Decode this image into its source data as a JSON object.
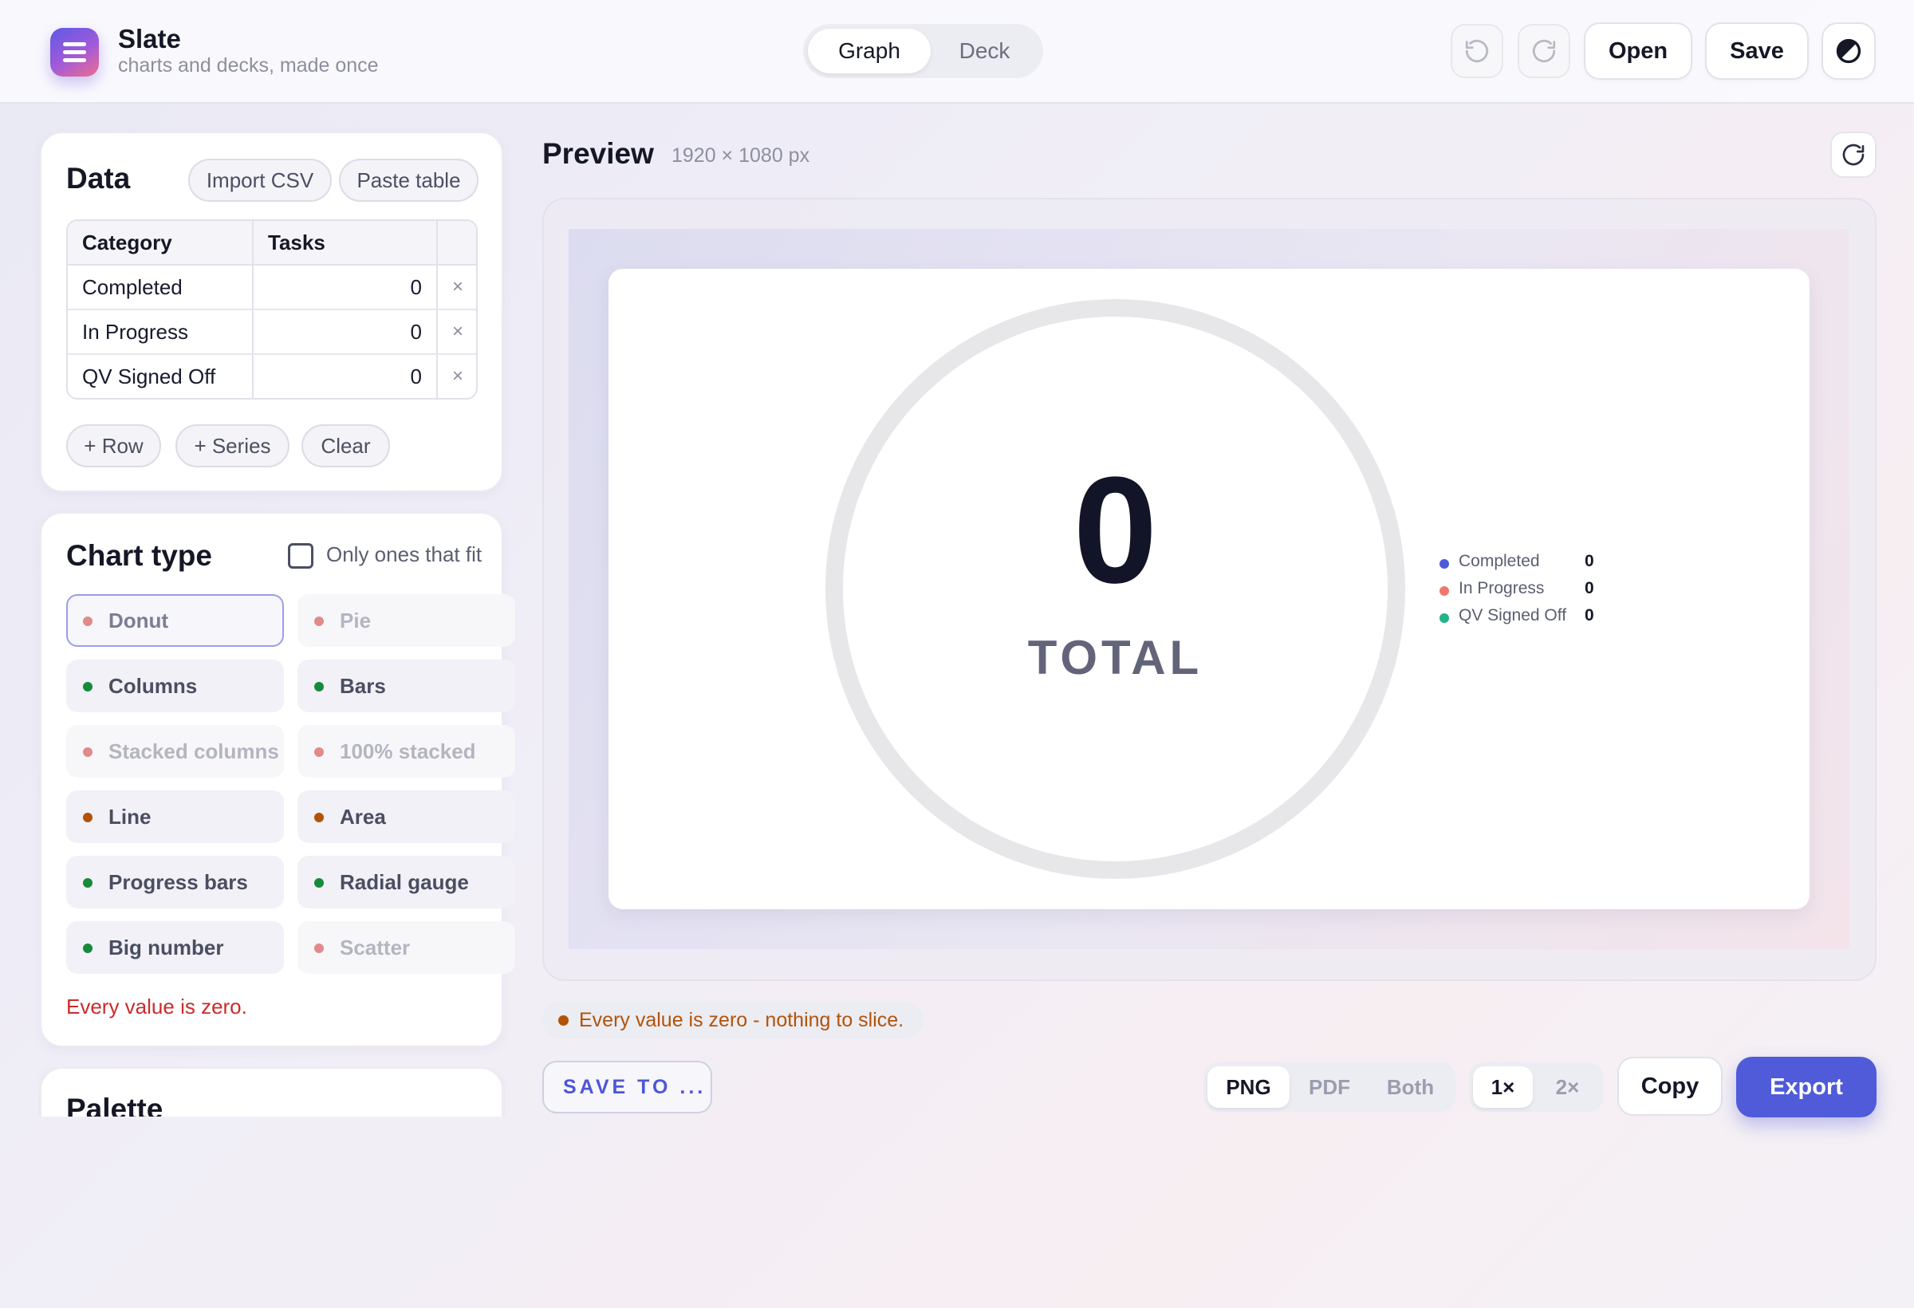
{
  "app": {
    "title": "Slate",
    "subtitle": "charts and decks, made once"
  },
  "mode_switch": {
    "options": [
      "Graph",
      "Deck"
    ],
    "active": "Graph"
  },
  "toolbar": {
    "open_label": "Open",
    "save_label": "Save",
    "undo_icon": "undo-icon",
    "redo_icon": "redo-icon",
    "theme_icon": "contrast-icon"
  },
  "data_panel": {
    "title": "Data",
    "import_label": "Import CSV",
    "paste_label": "Paste table",
    "columns": [
      "Category",
      "Tasks"
    ],
    "rows": [
      {
        "category": "Completed",
        "value": "0",
        "remove": "×"
      },
      {
        "category": "In Progress",
        "value": "0",
        "remove": "×"
      },
      {
        "category": "QV Signed Off",
        "value": "0",
        "remove": "×"
      }
    ],
    "add_row_label": "+ Row",
    "add_series_label": "+ Series",
    "clear_label": "Clear"
  },
  "chart_type_panel": {
    "title": "Chart type",
    "filter_label": "Only ones that fit",
    "filter_checked": false,
    "types": [
      {
        "label": "Donut",
        "status": "unfit",
        "selected": true
      },
      {
        "label": "Pie",
        "status": "unfit",
        "selected": false
      },
      {
        "label": "Columns",
        "status": "fit",
        "selected": false
      },
      {
        "label": "Bars",
        "status": "fit",
        "selected": false
      },
      {
        "label": "Stacked columns",
        "status": "unfit",
        "selected": false
      },
      {
        "label": "100% stacked",
        "status": "unfit",
        "selected": false
      },
      {
        "label": "Line",
        "status": "warn",
        "selected": false
      },
      {
        "label": "Area",
        "status": "warn",
        "selected": false
      },
      {
        "label": "Progress bars",
        "status": "fit",
        "selected": false
      },
      {
        "label": "Radial gauge",
        "status": "fit",
        "selected": false
      },
      {
        "label": "Big number",
        "status": "fit",
        "selected": false
      },
      {
        "label": "Scatter",
        "status": "unfit",
        "selected": false
      }
    ],
    "status_colors": {
      "fit": "#178a3c",
      "warn": "#b25308",
      "unfit": "#e08a8a"
    },
    "error_text": "Every value is zero."
  },
  "palette_panel": {
    "title": "Palette"
  },
  "preview": {
    "title": "Preview",
    "dimensions": "1920 × 1080 px",
    "refresh_icon": "refresh-icon",
    "total_value": "0",
    "total_label": "TOTAL",
    "legend": [
      {
        "name": "Completed",
        "value": "0",
        "color": "#4f5bd9"
      },
      {
        "name": "In Progress",
        "value": "0",
        "color": "#f0786a"
      },
      {
        "name": "QV Signed Off",
        "value": "0",
        "color": "#22b38a"
      }
    ],
    "warning": "Every value is zero - nothing to slice."
  },
  "chart_data": {
    "type": "pie",
    "categories": [
      "Completed",
      "In Progress",
      "QV Signed Off"
    ],
    "values": [
      0,
      0,
      0
    ],
    "total": 0,
    "center_label": "TOTAL",
    "legend_position": "right"
  },
  "export_bar": {
    "save_to_label": "SAVE TO ...",
    "formats": [
      "PNG",
      "PDF",
      "Both"
    ],
    "active_format": "PNG",
    "scales": [
      "1×",
      "2×"
    ],
    "active_scale": "1×",
    "copy_label": "Copy",
    "export_label": "Export"
  },
  "colors": {
    "accent": "#4f5bd9",
    "error": "#cc2b2b",
    "warning": "#b25308"
  }
}
